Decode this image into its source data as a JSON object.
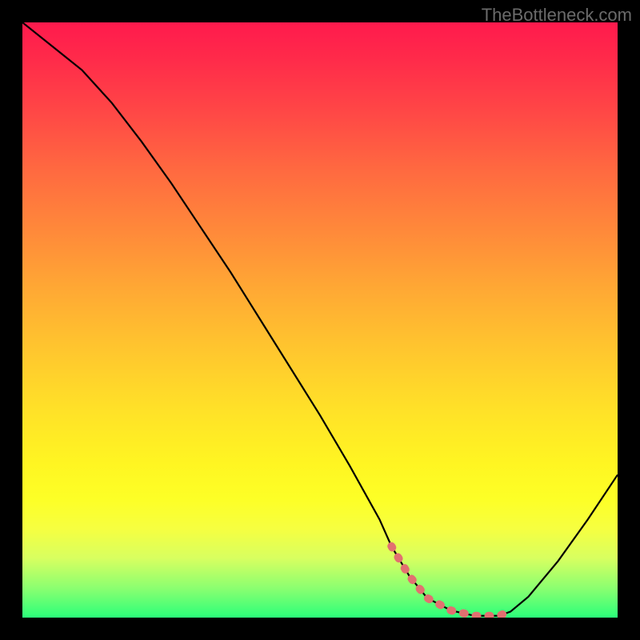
{
  "watermark": "TheBottleneck.com",
  "chart_data": {
    "type": "line",
    "title": "",
    "xlabel": "",
    "ylabel": "",
    "xlim": [
      0,
      100
    ],
    "ylim": [
      0,
      100
    ],
    "series": [
      {
        "name": "bottleneck-curve",
        "x": [
          0,
          5,
          10,
          15,
          20,
          25,
          30,
          35,
          40,
          45,
          50,
          55,
          60,
          62,
          65,
          68,
          72,
          76,
          80,
          82,
          85,
          90,
          95,
          100
        ],
        "y": [
          100,
          96,
          92,
          86.5,
          80,
          73,
          65.5,
          58,
          50,
          42,
          34,
          25.5,
          16.5,
          12,
          7,
          3.3,
          1.2,
          0.3,
          0.3,
          1,
          3.5,
          9.5,
          16.5,
          24
        ]
      }
    ],
    "highlight_segment": {
      "name": "optimal-range",
      "color": "#e27070",
      "x": [
        62,
        65,
        68,
        72,
        76,
        80,
        82
      ],
      "y": [
        12,
        7,
        3.3,
        1.2,
        0.3,
        0.3,
        1
      ]
    },
    "background": {
      "type": "vertical-gradient",
      "stops": [
        {
          "pos": 0,
          "color": "#ff1a4d"
        },
        {
          "pos": 50,
          "color": "#ffb030"
        },
        {
          "pos": 80,
          "color": "#fdff26"
        },
        {
          "pos": 100,
          "color": "#2bff7a"
        }
      ]
    }
  }
}
